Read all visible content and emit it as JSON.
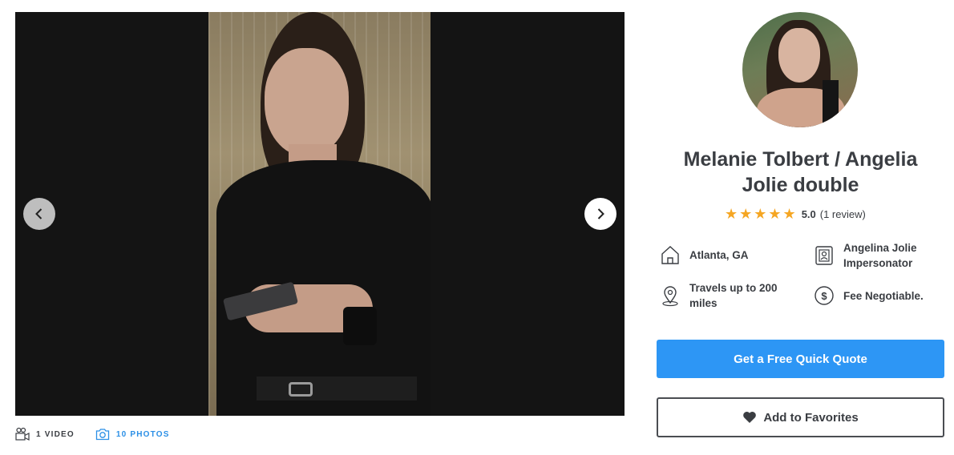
{
  "gallery": {
    "prev_icon": "chevron-left-icon",
    "next_icon": "chevron-right-icon"
  },
  "media": {
    "video_icon": "video-camera-icon",
    "video_label": "1 VIDEO",
    "photos_icon": "camera-icon",
    "photos_label": "10 PHOTOS"
  },
  "profile": {
    "name": "Melanie Tolbert / Angelia Jolie double",
    "stars": "★★★★★",
    "rating_score": "5.0",
    "rating_count": "(1 review)",
    "facts": {
      "location": "Atlanta, GA",
      "location_icon": "home-icon",
      "category": "Angelina Jolie Impersonator",
      "category_icon": "contact-card-icon",
      "travel": "Travels up to 200 miles",
      "travel_icon": "map-pin-icon",
      "fee": "Fee Negotiable.",
      "fee_icon": "dollar-icon"
    }
  },
  "actions": {
    "quote_label": "Get a Free Quick Quote",
    "favorite_label": "Add to Favorites",
    "favorite_icon": "heart-icon"
  },
  "colors": {
    "accent": "#2d96f5",
    "star": "#f5a623",
    "text": "#3a3d42"
  }
}
